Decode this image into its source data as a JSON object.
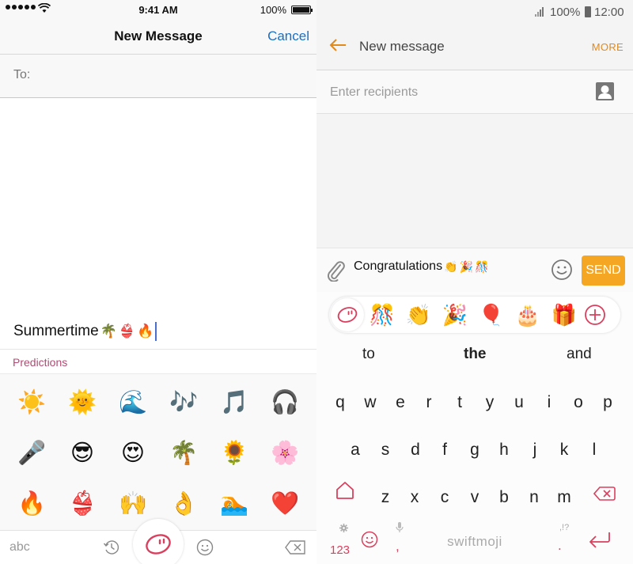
{
  "ios": {
    "status_bar": {
      "time": "9:41 AM",
      "battery": "100%",
      "signal_icon": "signal-dots-icon",
      "wifi_icon": "wifi-icon",
      "battery_icon": "battery-full-icon"
    },
    "nav": {
      "title": "New Message",
      "cancel_label": "Cancel"
    },
    "to_field": {
      "label": "To:",
      "value": ""
    },
    "compose": {
      "text": "Summertime",
      "emojis": [
        "🌴",
        "👙",
        "🔥"
      ]
    },
    "predictions_label": "Predictions",
    "emoji_grid": [
      [
        "☀️",
        "🌞",
        "🌊",
        "🎶",
        "🎵",
        "🎧"
      ],
      [
        "🎤",
        "😎",
        "😍",
        "🌴",
        "🌻",
        "🌸"
      ],
      [
        "🔥",
        "👙",
        "🙌",
        "👌",
        "🏊",
        "❤️"
      ]
    ],
    "bottom_bar": {
      "abc_label": "abc",
      "history_icon": "history-icon",
      "swiftmoji_icon": "swiftmoji-logo-icon",
      "emoji_icon": "smiley-icon",
      "delete_icon": "backspace-icon"
    }
  },
  "android": {
    "status_bar": {
      "battery": "100%",
      "time": "12:00"
    },
    "app_bar": {
      "title": "New message",
      "more_label": "MORE"
    },
    "recipients": {
      "placeholder": "Enter recipients",
      "value": ""
    },
    "compose": {
      "text": "Congratulations",
      "emojis": [
        "👏",
        "🎉",
        "🎊"
      ],
      "send_label": "SEND"
    },
    "emoji_strip": [
      "🎊",
      "👏",
      "🎉",
      "🎈",
      "🎂",
      "🎁"
    ],
    "suggestions": [
      "to",
      "the",
      "and"
    ],
    "rows": [
      [
        "q",
        "w",
        "e",
        "r",
        "t",
        "y",
        "u",
        "i",
        "o",
        "p"
      ],
      [
        "a",
        "s",
        "d",
        "f",
        "g",
        "h",
        "j",
        "k",
        "l"
      ],
      [
        "z",
        "x",
        "c",
        "v",
        "b",
        "n",
        "m"
      ]
    ],
    "bottom_row": {
      "num_label": "123",
      "comma": ",",
      "space_label": "swiftmoji",
      "punct_label": ",!?",
      "period": "."
    },
    "colors": {
      "accent_orange": "#f5a623",
      "more_orange": "#e08a1e",
      "swiftmoji_red": "#d9405e",
      "cancel_blue": "#1a6fc4",
      "predictions_pink": "#b24b73"
    }
  }
}
